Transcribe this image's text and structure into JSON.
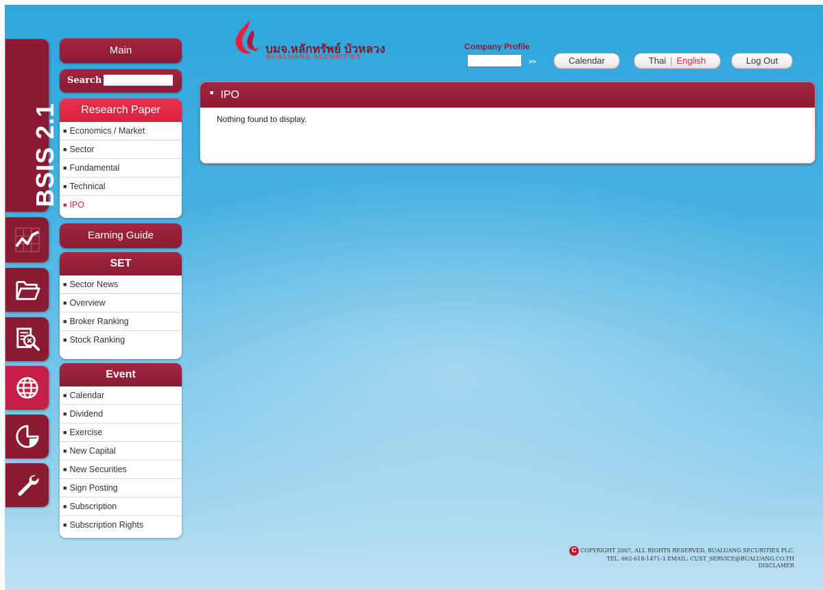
{
  "brand": {
    "product": "BSIS 2.1"
  },
  "logo": {
    "thai": "บมจ.หลักทรัพย์ บัวหลวง",
    "english": "BUALUANG SECURITIES"
  },
  "header": {
    "company_profile_label": "Company Profile",
    "company_profile_value": "",
    "go_label": ">>",
    "calendar_label": "Calendar",
    "lang_thai": "Thai",
    "lang_sep": "|",
    "lang_english": "English",
    "logout_label": "Log Out"
  },
  "sidebar": {
    "main_label": "Main",
    "search_label": "Search",
    "search_value": "",
    "research": {
      "title": "Research Paper",
      "items": [
        "Economics / Market",
        "Sector",
        "Fundamental",
        "Technical",
        "IPO"
      ],
      "selected": "IPO"
    },
    "earning_label": "Earning Guide",
    "set": {
      "title": "SET",
      "items": [
        "Sector News",
        "Overview",
        "Broker Ranking",
        "Stock Ranking"
      ]
    },
    "event": {
      "title": "Event",
      "items": [
        "Calendar",
        "Dividend",
        "Exercise",
        "New Capital",
        "New Securities",
        "Sign Posting",
        "Subscription",
        "Subscription Rights"
      ]
    }
  },
  "vertical_tabs": [
    {
      "icon": "chart-icon",
      "active": false
    },
    {
      "icon": "folder-icon",
      "active": false
    },
    {
      "icon": "report-search-icon",
      "active": false
    },
    {
      "icon": "globe-icon",
      "active": true
    },
    {
      "icon": "pie-chart-icon",
      "active": false
    },
    {
      "icon": "wrench-icon",
      "active": false
    }
  ],
  "content": {
    "title": "IPO",
    "message": "Nothing found to display."
  },
  "footer": {
    "copyright": "COPYRIGHT 2007, ALL RIGHTS RESERVED, BUALUANG SECURITIES PLC.",
    "contact": "TEL. 662-618-1471-3 EMAIL: CUST_SERVICE@BUALUANG.CO.TH",
    "disclaimer": "DISCLAMER"
  },
  "colors": {
    "maroon": "#8a1b33",
    "red": "#d6213f",
    "sky": "#46b1e1"
  }
}
